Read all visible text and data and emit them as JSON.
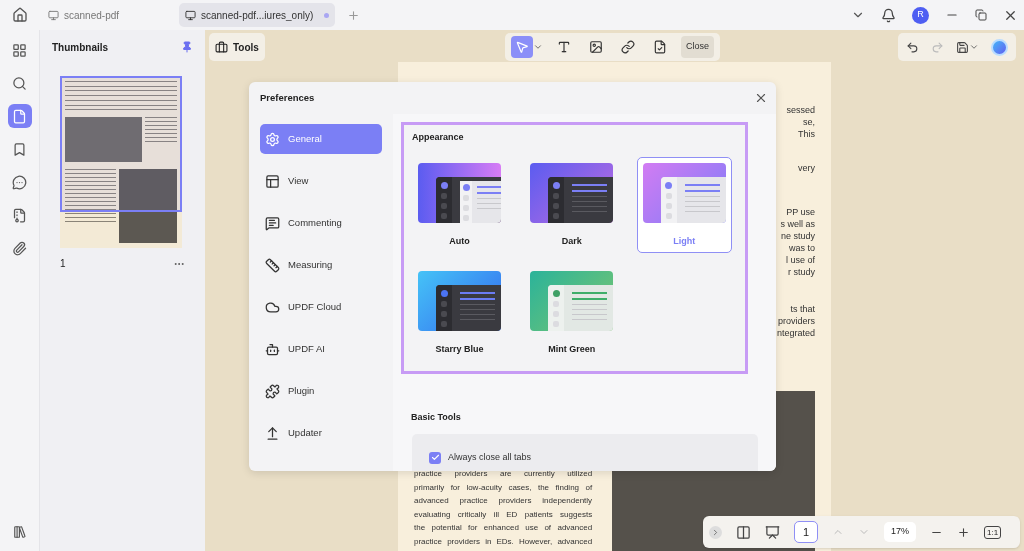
{
  "tabs": [
    {
      "label": "scanned-pdf",
      "selected": false
    },
    {
      "label": "scanned-pdf...iures_only)",
      "selected": true
    }
  ],
  "user": {
    "initial": "R"
  },
  "rail": [
    {
      "selected": false
    },
    {
      "selected": false
    },
    {
      "selected": true
    },
    {
      "selected": false
    },
    {
      "selected": false
    },
    {
      "selected": false
    },
    {
      "selected": false
    }
  ],
  "thumbnails": {
    "title": "Thumbnails",
    "pages": [
      {
        "number": "1",
        "selected": true
      }
    ]
  },
  "toolbar": {
    "tools_label": "Tools",
    "tools": [
      {
        "selected": true
      },
      {
        "selected": false
      },
      {
        "selected": false
      },
      {
        "selected": false
      },
      {
        "selected": false
      }
    ],
    "close_label": "Close"
  },
  "document": {
    "right_fragments": [
      [
        "sessed",
        "se,",
        "This"
      ],
      [
        "very"
      ],
      [
        "PP use",
        "s well as",
        "ne study",
        "was to",
        "l use of",
        "r study"
      ],
      [
        "ts that",
        "providers",
        "ntegrated"
      ]
    ],
    "bottom_lines": [
      "practice providers are currently utilized",
      "primarily for low-acuity cases, the finding of",
      "advanced practice providers independently",
      "evaluating critically ill ED patients suggests",
      "the potential for enhanced use of advanced",
      "practice providers in EDs. However, advanced"
    ]
  },
  "dialog": {
    "title": "Preferences",
    "nav": [
      {
        "label": "General",
        "selected": true
      },
      {
        "label": "View",
        "selected": false
      },
      {
        "label": "Commenting",
        "selected": false
      },
      {
        "label": "Measuring",
        "selected": false
      },
      {
        "label": "UPDF Cloud",
        "selected": false
      },
      {
        "label": "UPDF AI",
        "selected": false
      },
      {
        "label": "Plugin",
        "selected": false
      },
      {
        "label": "Updater",
        "selected": false
      }
    ],
    "appearance": {
      "title": "Appearance",
      "themes": [
        {
          "label": "Auto",
          "kind": "auto",
          "selected": false
        },
        {
          "label": "Dark",
          "kind": "dark",
          "selected": false
        },
        {
          "label": "Light",
          "kind": "light",
          "selected": true
        },
        {
          "label": "Starry Blue",
          "kind": "starry",
          "selected": false
        },
        {
          "label": "Mint Green",
          "kind": "mint",
          "selected": false
        }
      ]
    },
    "basic_tools": {
      "title": "Basic Tools",
      "options": [
        {
          "label": "Always close all tabs",
          "checked": true
        }
      ]
    }
  },
  "page_nav": {
    "page": "1",
    "zoom": "17%",
    "actual_size": "1:1"
  }
}
